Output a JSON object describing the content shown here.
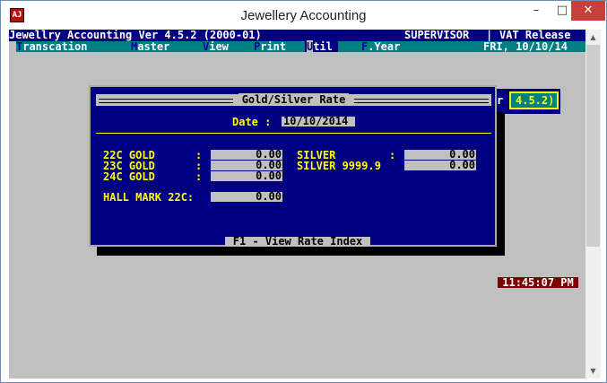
{
  "window": {
    "title": "Jewellery Accounting",
    "minimize": "–",
    "maximize": "□",
    "close": "✕",
    "icon_text": "AJ"
  },
  "statusbar": {
    "app_version": "Jewellry Accounting Ver 4.5.2 (2000-01)",
    "user": "SUPERVISOR",
    "separator": "|",
    "edition": "VAT Release"
  },
  "menu": {
    "items": [
      {
        "hot": "T",
        "rest": "ranscation"
      },
      {
        "hot": "M",
        "rest": "aster"
      },
      {
        "hot": "V",
        "rest": "iew"
      },
      {
        "hot": "P",
        "rest": "rint"
      },
      {
        "hot": "U",
        "rest": "til"
      },
      {
        "hot": "F",
        "rest": ".Year"
      }
    ],
    "date_display": "FRI, 10/10/14"
  },
  "version_badge": {
    "prefix": "r",
    "text": "4.5.2)"
  },
  "dialog": {
    "title": "Gold/Silver Rate",
    "date_label": "Date :",
    "date_value": "10/10/2014",
    "gold_22_label": "22C GOLD",
    "gold_23_label": "23C GOLD",
    "gold_24_label": "24C GOLD",
    "colon": ":",
    "gold_22_value": "0.00",
    "gold_23_value": "0.00",
    "gold_24_value": "0.00",
    "silver_label": "SILVER",
    "silver_9999_label": "SILVER 9999.9",
    "silver_value": "0.00",
    "silver_9999_value": "0.00",
    "hallmark_label": "HALL MARK 22C:",
    "hallmark_value": "0.00",
    "footer": "F1 - View Rate Index"
  },
  "clock": "11:45:07 PM",
  "colors": {
    "console_bg": "#c0c0c0",
    "navy": "#000080",
    "teal": "#008080",
    "yellow": "#ffff00",
    "clock_bg": "#800000",
    "close_btn": "#c7413a"
  }
}
